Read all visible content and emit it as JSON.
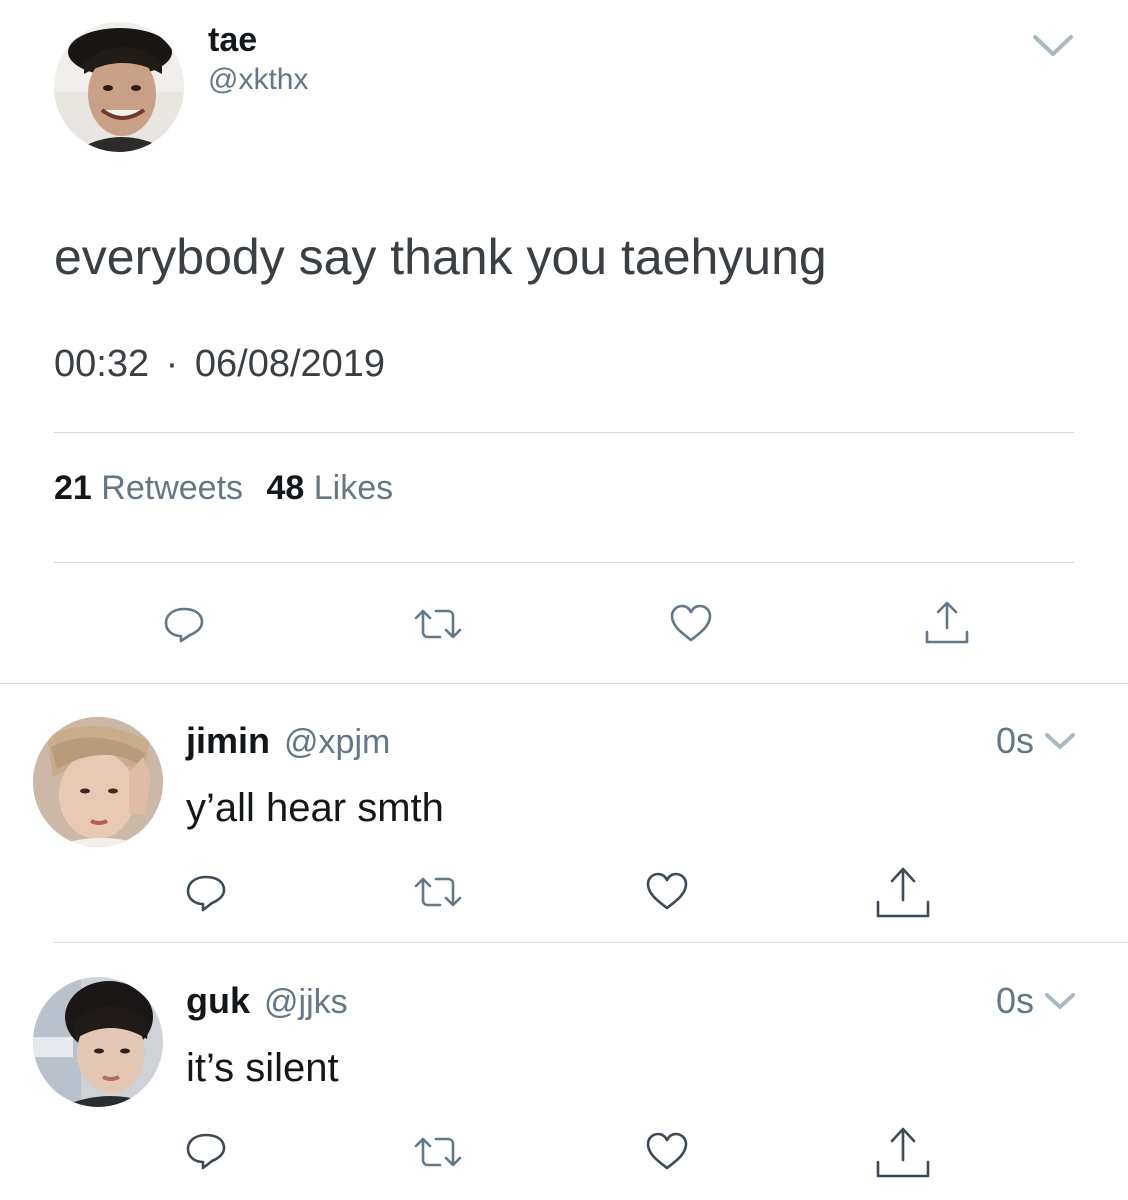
{
  "main_tweet": {
    "display_name": "tae",
    "handle": "@xkthx",
    "text": "everybody say thank you taehyung",
    "time": "00:32",
    "separator": "·",
    "date": "06/08/2019",
    "retweets_count": "21",
    "retweets_label": "Retweets",
    "likes_count": "48",
    "likes_label": "Likes",
    "avatar_icon": "avatar-tae",
    "menu_icon": "chevron-down-icon"
  },
  "replies": [
    {
      "display_name": "jimin",
      "handle": "@xpjm",
      "text": "y’all hear smth",
      "time": "0s",
      "avatar_icon": "avatar-jimin"
    },
    {
      "display_name": "guk",
      "handle": "@jjks",
      "text": "it’s silent",
      "time": "0s",
      "avatar_icon": "avatar-guk"
    }
  ],
  "colors": {
    "text": "#14171a",
    "secondary": "#657786",
    "divider": "#d5dbe0",
    "background": "#ffffff"
  }
}
